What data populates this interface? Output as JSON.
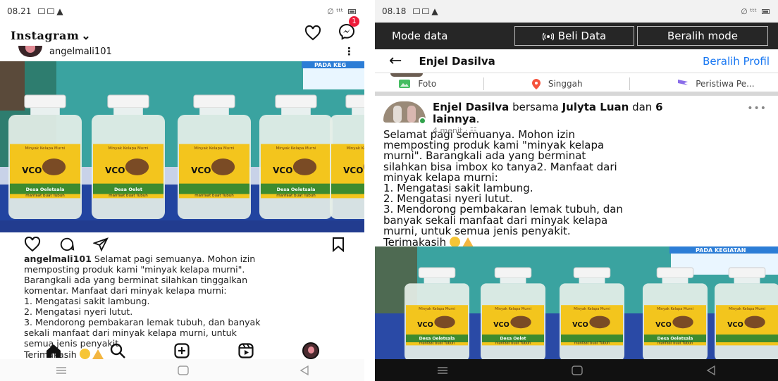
{
  "left_screen": {
    "status": {
      "time": "08.21",
      "signal": "∅ ᵗᵗᵗ"
    },
    "header": {
      "logo": "Instagram",
      "dropdown_glyph": "⌄",
      "messages_badge": "1"
    },
    "post": {
      "username": "angelmali101",
      "more_glyph": "⋮",
      "caption_username": "angelmali101",
      "caption_lines": [
        " Selamat pagi semuanya. Mohon izin",
        "memposting produk kami \"minyak kelapa murni\".",
        "Barangkali ada yang berminat silahkan tinggalkan",
        "komentar.  Manfaat dari minyak kelapa murni:",
        "1. Mengatasi sakit lambung.",
        "2. Mengatasi nyeri lutut.",
        "3. Mendorong pembakaran lemak tubuh, dan banyak",
        "sekali manfaat dari minyak kelapa murni, untuk",
        "semua jenis penyakit.",
        "Terimakasih"
      ]
    },
    "photo": {
      "banner": "PADA KEG",
      "bottle_labels": [
        {
          "top": "Minyak Kelapa Murni",
          "brand": "VCO",
          "sub": "Desa Oeletsala",
          "foot": "manfaat buat Tubuh"
        },
        {
          "top": "Minyak Kelapa Murni",
          "brand": "VCO",
          "sub": "Desa Oelet",
          "foot": "manfaat buat Tubuh"
        },
        {
          "top": "Minyak Kelapa Murni",
          "brand": "VCO",
          "sub": "",
          "foot": "manfaat buat Tubuh"
        },
        {
          "top": "Minyak Kelapa Murni",
          "brand": "VCO",
          "sub": "Desa Oeletsala",
          "foot": "manfaat buat Tubuh"
        },
        {
          "top": "Minyak Kelapa Murni",
          "brand": "VCO",
          "sub": "",
          "foot": ""
        }
      ]
    }
  },
  "right_screen": {
    "status": {
      "time": "08.18",
      "signal": "∅ ᵗᵗᵗ"
    },
    "data_bar": {
      "mode": "Mode data",
      "buy": "Beli Data",
      "switch": "Beralih mode"
    },
    "header": {
      "back_glyph": "←",
      "name": "Enjel Dasilva",
      "switch_profile": "Beralih Profil"
    },
    "chips": [
      {
        "label": "Foto",
        "icon": "photo-icon",
        "color": "#45bd62"
      },
      {
        "label": "Singgah",
        "icon": "location-pin-icon",
        "color": "#f5533d"
      },
      {
        "label": "Peristiwa Pe...",
        "icon": "flag-icon",
        "color": "#8a6de9"
      }
    ],
    "post": {
      "author": "Enjel Dasilva",
      "with": " bersama ",
      "tagged": "Julyta Luan",
      "and": " dan ",
      "others": "6 lainnya",
      "period": ".",
      "meta": "4 menit · ☷",
      "more_glyph": "•••",
      "text_lines": [
        "Selamat pagi semuanya. Mohon izin",
        "memposting produk kami \"minyak kelapa",
        "murni\". Barangkali ada yang berminat",
        "silahkan bisa imbox ko tanya2.  Manfaat dari",
        "minyak kelapa murni:",
        "1. Mengatasi sakit lambung.",
        "2. Mengatasi nyeri lutut.",
        "3. Mendorong pembakaran lemak tubuh, dan",
        "banyak sekali manfaat dari minyak kelapa",
        "murni, untuk semua jenis penyakit.",
        "Terimakasih"
      ]
    },
    "photo": {
      "banner": "PADA KEGIATAN"
    }
  }
}
